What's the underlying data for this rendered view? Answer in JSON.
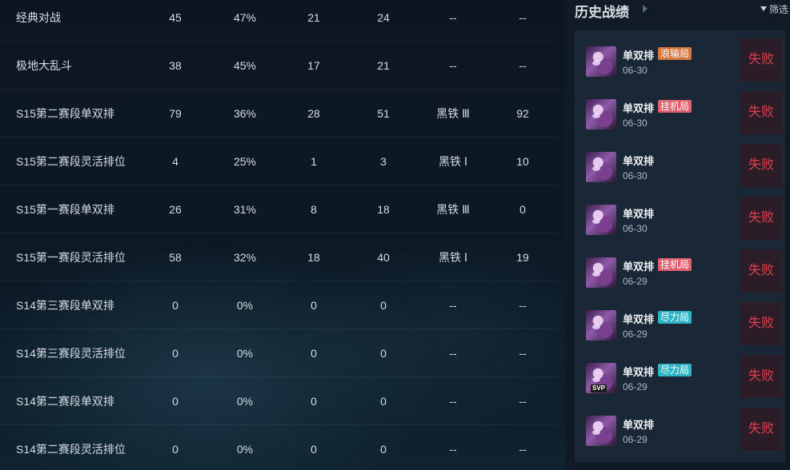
{
  "stats": {
    "rows": [
      {
        "name": "经典对战",
        "c1": "45",
        "c2": "47%",
        "c3": "21",
        "c4": "24",
        "c5": "--",
        "c6": "--"
      },
      {
        "name": "极地大乱斗",
        "c1": "38",
        "c2": "45%",
        "c3": "17",
        "c4": "21",
        "c5": "--",
        "c6": "--"
      },
      {
        "name": "S15第二赛段单双排",
        "c1": "79",
        "c2": "36%",
        "c3": "28",
        "c4": "51",
        "c5": "黑铁 Ⅲ",
        "c6": "92"
      },
      {
        "name": "S15第二赛段灵活排位",
        "c1": "4",
        "c2": "25%",
        "c3": "1",
        "c4": "3",
        "c5": "黑铁 Ⅰ",
        "c6": "10"
      },
      {
        "name": "S15第一赛段单双排",
        "c1": "26",
        "c2": "31%",
        "c3": "8",
        "c4": "18",
        "c5": "黑铁 Ⅲ",
        "c6": "0"
      },
      {
        "name": "S15第一赛段灵活排位",
        "c1": "58",
        "c2": "32%",
        "c3": "18",
        "c4": "40",
        "c5": "黑铁 Ⅰ",
        "c6": "19"
      },
      {
        "name": "S14第三赛段单双排",
        "c1": "0",
        "c2": "0%",
        "c3": "0",
        "c4": "0",
        "c5": "--",
        "c6": "--"
      },
      {
        "name": "S14第三赛段灵活排位",
        "c1": "0",
        "c2": "0%",
        "c3": "0",
        "c4": "0",
        "c5": "--",
        "c6": "--"
      },
      {
        "name": "S14第二赛段单双排",
        "c1": "0",
        "c2": "0%",
        "c3": "0",
        "c4": "0",
        "c5": "--",
        "c6": "--"
      },
      {
        "name": "S14第二赛段灵活排位",
        "c1": "0",
        "c2": "0%",
        "c3": "0",
        "c4": "0",
        "c5": "--",
        "c6": "--"
      }
    ]
  },
  "history": {
    "title": "历史战绩",
    "filter_label": "筛选",
    "matches": [
      {
        "mode": "单双排",
        "tag": "浪输局",
        "tag_color": "#d7763a",
        "date": "06-30",
        "result": "失败",
        "svp": ""
      },
      {
        "mode": "单双排",
        "tag": "挂机局",
        "tag_color": "#e0606e",
        "date": "06-30",
        "result": "失败",
        "svp": ""
      },
      {
        "mode": "单双排",
        "tag": "",
        "tag_color": "",
        "date": "06-30",
        "result": "失败",
        "svp": ""
      },
      {
        "mode": "单双排",
        "tag": "",
        "tag_color": "",
        "date": "06-30",
        "result": "失败",
        "svp": ""
      },
      {
        "mode": "单双排",
        "tag": "挂机局",
        "tag_color": "#e0606e",
        "date": "06-29",
        "result": "失败",
        "svp": ""
      },
      {
        "mode": "单双排",
        "tag": "尽力局",
        "tag_color": "#2fb4c7",
        "date": "06-29",
        "result": "失败",
        "svp": ""
      },
      {
        "mode": "单双排",
        "tag": "尽力局",
        "tag_color": "#2fb4c7",
        "date": "06-29",
        "result": "失败",
        "svp": "SVP"
      },
      {
        "mode": "单双排",
        "tag": "",
        "tag_color": "",
        "date": "06-29",
        "result": "失败",
        "svp": ""
      }
    ]
  },
  "colors": {
    "loss": "#e0404f",
    "panel": "#1a2737"
  }
}
